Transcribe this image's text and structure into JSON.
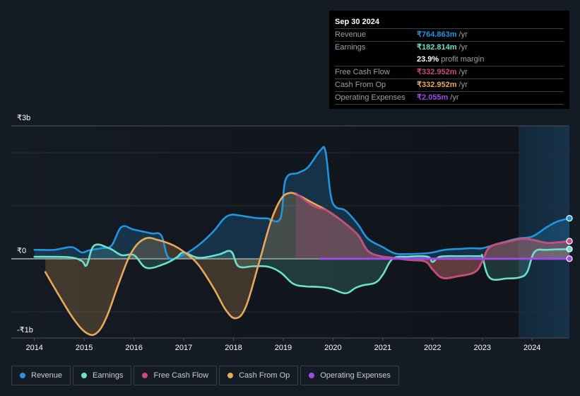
{
  "tooltip": {
    "date": "Sep 30 2024",
    "rows": [
      {
        "label": "Revenue",
        "value": "₹764.863m",
        "unit": "/yr",
        "color": "#2394df"
      },
      {
        "label": "Earnings",
        "value": "₹182.814m",
        "unit": "/yr",
        "color": "#6ce0c9"
      },
      {
        "label": "",
        "value": "23.9%",
        "unit": "profit margin",
        "color": "#ffffff"
      },
      {
        "label": "Free Cash Flow",
        "value": "₹332.952m",
        "unit": "/yr",
        "color": "#c84a7f"
      },
      {
        "label": "Cash From Op",
        "value": "₹332.952m",
        "unit": "/yr",
        "color": "#e9a95a"
      },
      {
        "label": "Operating Expenses",
        "value": "₹2.055m",
        "unit": "/yr",
        "color": "#a049e6"
      }
    ]
  },
  "legend": [
    {
      "label": "Revenue",
      "color": "#2394df"
    },
    {
      "label": "Earnings",
      "color": "#6ce0c9"
    },
    {
      "label": "Free Cash Flow",
      "color": "#c84a7f"
    },
    {
      "label": "Cash From Op",
      "color": "#e9a95a"
    },
    {
      "label": "Operating Expenses",
      "color": "#a049e6"
    }
  ],
  "chart_data": {
    "type": "area",
    "title": "",
    "xlabel": "",
    "ylabel": "",
    "y_unit": "₹b",
    "ylim": [
      -1.5,
      2.5
    ],
    "xlim": [
      2013.7,
      2024.75
    ],
    "ytick_labels": [
      {
        "value": 2.5,
        "label": "₹3b"
      },
      {
        "value": 0,
        "label": "₹0"
      },
      {
        "value": -1.5,
        "label": "-₹1b"
      }
    ],
    "gridlines": [
      2,
      1,
      0,
      -1
    ],
    "xticks": [
      2014,
      2015,
      2016,
      2017,
      2018,
      2019,
      2020,
      2021,
      2022,
      2023,
      2024
    ],
    "xtick_labels": [
      "2014",
      "2015",
      "2016",
      "2017",
      "2018",
      "2019",
      "2020",
      "2021",
      "2022",
      "2023",
      "2024"
    ],
    "highlight_range": [
      2023.73,
      2024.75
    ],
    "legend_position": "bottom",
    "series": [
      {
        "name": "Revenue",
        "color": "#2394df",
        "x": [
          2014.0,
          2014.4,
          2014.75,
          2014.95,
          2015.1,
          2015.35,
          2015.55,
          2015.75,
          2016.0,
          2016.35,
          2016.55,
          2016.7,
          2017.0,
          2017.3,
          2017.6,
          2017.8,
          2017.95,
          2018.1,
          2018.45,
          2018.7,
          2018.75,
          2018.95,
          2019.05,
          2019.3,
          2019.5,
          2019.75,
          2019.85,
          2019.95,
          2020.05,
          2020.25,
          2020.5,
          2020.7,
          2021.0,
          2021.25,
          2021.5,
          2021.8,
          2022.0,
          2022.25,
          2022.6,
          2022.8,
          2023.0,
          2023.3,
          2023.7,
          2024.0,
          2024.3,
          2024.5,
          2024.75
        ],
        "values": [
          0.17,
          0.17,
          0.22,
          0.12,
          0.16,
          0.2,
          0.25,
          0.6,
          0.55,
          0.48,
          0.44,
          0.02,
          0.08,
          0.26,
          0.52,
          0.75,
          0.83,
          0.82,
          0.77,
          0.76,
          0.73,
          0.78,
          1.5,
          1.62,
          1.73,
          2.05,
          2.02,
          1.22,
          0.98,
          0.91,
          0.65,
          0.38,
          0.22,
          0.1,
          0.09,
          0.1,
          0.12,
          0.17,
          0.19,
          0.2,
          0.2,
          0.28,
          0.38,
          0.42,
          0.6,
          0.7,
          0.765
        ]
      },
      {
        "name": "Earnings",
        "color": "#6ce0c9",
        "x": [
          2014.0,
          2014.7,
          2014.95,
          2015.05,
          2015.2,
          2015.5,
          2015.75,
          2016.0,
          2016.25,
          2016.6,
          2016.85,
          2017.0,
          2017.3,
          2017.7,
          2017.95,
          2018.1,
          2018.4,
          2018.7,
          2018.95,
          2019.2,
          2019.45,
          2019.7,
          2019.95,
          2020.25,
          2020.45,
          2020.6,
          2020.85,
          2021.0,
          2021.2,
          2021.5,
          2021.9,
          2022.0,
          2022.15,
          2022.5,
          2022.95,
          2023.0,
          2023.15,
          2023.5,
          2023.75,
          2023.9,
          2024.05,
          2024.3,
          2024.75
        ],
        "values": [
          0.04,
          0.03,
          -0.04,
          -0.12,
          0.25,
          0.2,
          0.07,
          0.07,
          -0.17,
          -0.1,
          0.02,
          0.12,
          0.02,
          0.08,
          0.14,
          -0.14,
          -0.14,
          -0.15,
          -0.26,
          -0.47,
          -0.52,
          -0.53,
          -0.56,
          -0.65,
          -0.55,
          -0.5,
          -0.45,
          -0.3,
          0.0,
          0.04,
          0.04,
          -0.06,
          0.04,
          0.05,
          0.05,
          0.04,
          -0.36,
          -0.37,
          -0.35,
          -0.25,
          0.13,
          0.17,
          0.183
        ]
      },
      {
        "name": "Cash From Op",
        "color": "#e9a95a",
        "x": [
          2014.22,
          2014.5,
          2014.8,
          2015.05,
          2015.25,
          2015.45,
          2015.7,
          2015.95,
          2016.22,
          2016.5,
          2016.8,
          2017.05,
          2017.3,
          2017.6,
          2017.85,
          2018.05,
          2018.25,
          2018.5,
          2018.75,
          2018.95,
          2019.12,
          2019.3,
          2019.6,
          2019.9,
          2020.2,
          2020.5,
          2020.7,
          2020.95,
          2021.2,
          2021.5,
          2021.85,
          2022.0,
          2022.2,
          2022.5,
          2022.85,
          2023.0,
          2023.15,
          2023.5,
          2023.8,
          2024.0,
          2024.3,
          2024.5,
          2024.75
        ],
        "values": [
          -0.25,
          -0.7,
          -1.15,
          -1.4,
          -1.4,
          -1.1,
          -0.45,
          0.12,
          0.38,
          0.35,
          0.25,
          0.1,
          -0.12,
          -0.55,
          -0.97,
          -1.12,
          -0.9,
          -0.12,
          0.7,
          1.12,
          1.24,
          1.2,
          1.05,
          0.9,
          0.7,
          0.45,
          0.15,
          0.05,
          0.02,
          -0.02,
          -0.05,
          -0.2,
          -0.36,
          -0.33,
          -0.25,
          -0.05,
          0.22,
          0.32,
          0.38,
          0.36,
          0.3,
          0.31,
          0.333
        ]
      },
      {
        "name": "Free Cash Flow",
        "color": "#c84a7f",
        "x": [
          2019.25,
          2019.6,
          2019.9,
          2020.2,
          2020.5,
          2020.7,
          2020.95,
          2021.2,
          2021.5,
          2021.85,
          2022.0,
          2022.2,
          2022.5,
          2022.85,
          2023.0,
          2023.15,
          2023.5,
          2023.8,
          2024.0,
          2024.3,
          2024.5,
          2024.75
        ],
        "values": [
          1.24,
          1.0,
          0.9,
          0.7,
          0.45,
          0.15,
          0.05,
          0.02,
          -0.02,
          -0.05,
          -0.2,
          -0.36,
          -0.33,
          -0.25,
          -0.05,
          0.22,
          0.32,
          0.38,
          0.36,
          0.3,
          0.31,
          0.333
        ]
      },
      {
        "name": "Operating Expenses",
        "color": "#a049e6",
        "x": [
          2019.75,
          2024.75
        ],
        "values": [
          0.002,
          0.002
        ]
      }
    ]
  }
}
